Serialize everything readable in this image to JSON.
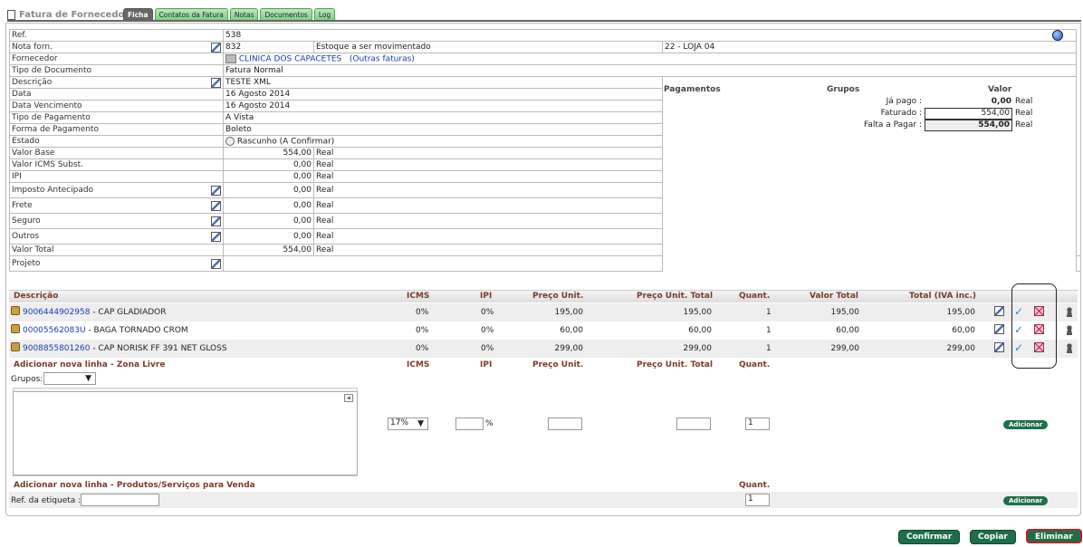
{
  "header": {
    "title": "Fatura de Fornecedor",
    "tabs": [
      {
        "label": "Ficha",
        "active": true
      },
      {
        "label": "Contatos da Fatura",
        "active": false
      },
      {
        "label": "Notas",
        "active": false
      },
      {
        "label": "Documentos",
        "active": false
      },
      {
        "label": "Log",
        "active": false
      }
    ]
  },
  "fields": {
    "ref_label": "Ref.",
    "ref_value": "538",
    "nota_label": "Nota forn.",
    "nota_value": "832",
    "estoque_label": "Estoque a ser movimentado",
    "estoque_value": "22 - LOJA 04",
    "fornecedor_label": "Fornecedor",
    "fornecedor_value": "CLINICA DOS CAPACETES",
    "outras_faturas": "(Outras faturas)",
    "tipo_doc_label": "Tipo de Documento",
    "tipo_doc_value": "Fatura Normal",
    "descricao_label": "Descrição",
    "descricao_value": "TESTE XML",
    "data_label": "Data",
    "data_value": "16 Agosto 2014",
    "data_venc_label": "Data Vencimento",
    "data_venc_value": "16 Agosto 2014",
    "tipo_pag_label": "Tipo de Pagamento",
    "tipo_pag_value": "A Vista",
    "forma_pag_label": "Forma de Pagamento",
    "forma_pag_value": "Boleto",
    "estado_label": "Estado",
    "estado_value": "Rascunho (A Confirmar)",
    "valor_base_label": "Valor Base",
    "valor_base_value": "554,00",
    "icms_subst_label": "Valor ICMS Subst.",
    "icms_subst_value": "0,00",
    "ipi_label": "IPI",
    "ipi_value": "0,00",
    "imposto_label": "Imposto Antecipado",
    "imposto_value": "0,00",
    "frete_label": "Frete",
    "frete_value": "0,00",
    "seguro_label": "Seguro",
    "seguro_value": "0,00",
    "outros_label": "Outros",
    "outros_value": "0,00",
    "valor_total_label": "Valor Total",
    "valor_total_value": "554,00",
    "projeto_label": "Projeto",
    "currency": "Real"
  },
  "payments": {
    "col_pagamentos": "Pagamentos",
    "col_grupos": "Grupos",
    "col_valor": "Valor",
    "ja_pago_label": "Já pago :",
    "ja_pago_value": "0,00",
    "faturado_label": "Faturado :",
    "faturado_value": "554,00",
    "falta_label": "Falta a Pagar :",
    "falta_value": "554,00",
    "currency": "Real"
  },
  "items": {
    "headers": [
      "Descrição",
      "ICMS",
      "IPI",
      "Preço Unit.",
      "Preço Unit. Total",
      "Quant.",
      "Valor Total",
      "Total (IVA inc.)"
    ],
    "rows": [
      {
        "code": "9006444902958",
        "desc": " - CAP GLADIADOR",
        "icms": "0%",
        "ipi": "0%",
        "pu": "195,00",
        "put": "195,00",
        "q": "1",
        "vt": "195,00",
        "ti": "195,00"
      },
      {
        "code": "00005562083U",
        "desc": " - BAGA TORNADO CROM",
        "icms": "0%",
        "ipi": "0%",
        "pu": "60,00",
        "put": "60,00",
        "q": "1",
        "vt": "60,00",
        "ti": "60,00"
      },
      {
        "code": "9008855801260",
        "desc": " - CAP NORISK FF 391 NET GLOSS",
        "icms": "0%",
        "ipi": "0%",
        "pu": "299,00",
        "put": "299,00",
        "q": "1",
        "vt": "299,00",
        "ti": "299,00"
      }
    ]
  },
  "add_free": {
    "title": "Adicionar nova linha - Zona Livre",
    "icms": "ICMS",
    "ipi": "IPI",
    "pu": "Preço Unit.",
    "put": "Preço Unit. Total",
    "q": "Quant.",
    "grupos_label": "Grupos:",
    "icms_select": "17%",
    "percent": "%",
    "quant_value": "1",
    "add_button": "Adicionar"
  },
  "add_products": {
    "title": "Adicionar nova linha - Produtos/Serviços para Venda",
    "q": "Quant.",
    "ref_label": "Ref. da etiqueta :",
    "quant_value": "1",
    "add_button": "Adicionar"
  },
  "footer": {
    "confirm": "Confirmar",
    "copy": "Copiar",
    "delete": "Eliminar"
  }
}
